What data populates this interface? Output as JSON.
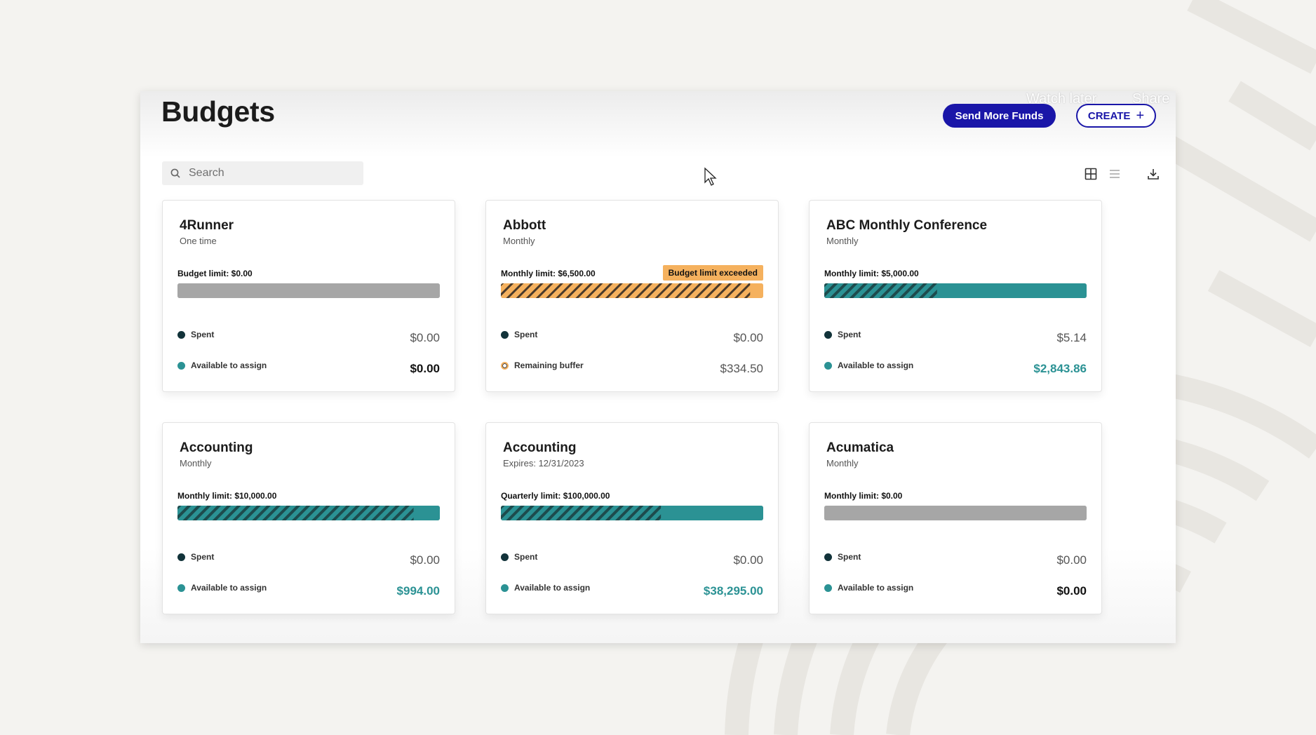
{
  "video_overlay": {
    "watch_later": "Watch later",
    "share": "Share"
  },
  "page": {
    "title": "Budgets"
  },
  "header": {
    "send_funds_label": "Send More Funds",
    "create_label": "CREATE",
    "create_icon": "plus-icon"
  },
  "search": {
    "placeholder": "Search",
    "icon": "search-icon"
  },
  "view_controls": {
    "grid_icon": "grid-view-icon",
    "list_icon": "list-view-icon",
    "download_icon": "download-icon"
  },
  "colors": {
    "accent": "#1a16a8",
    "teal": "#2b9294",
    "dark_teal": "#1d4b4d",
    "orange": "#f5b15e",
    "gray_bar": "#a6a6a6",
    "spent_dot": "#12333a"
  },
  "cards": [
    {
      "title": "4Runner",
      "subtitle": "One time",
      "limit_label": "Budget limit: $0.00",
      "badge": "",
      "bar_style": "empty",
      "spent_fraction": 0,
      "row1": {
        "label": "Spent",
        "value": "$0.00",
        "style": "normal",
        "dot": "spent"
      },
      "row2": {
        "label": "Available to assign",
        "value": "$0.00",
        "style": "strong",
        "dot": "available"
      }
    },
    {
      "title": "Abbott",
      "subtitle": "Monthly",
      "limit_label": "Monthly limit: $6,500.00",
      "badge": "Budget limit exceeded",
      "bar_style": "exceeded",
      "spent_fraction": 0.95,
      "row1": {
        "label": "Spent",
        "value": "$0.00",
        "style": "normal",
        "dot": "spent"
      },
      "row2": {
        "label": "Remaining buffer",
        "value": "$334.50",
        "style": "normal",
        "dot": "buffer"
      }
    },
    {
      "title": "ABC Monthly Conference",
      "subtitle": "Monthly",
      "limit_label": "Monthly limit: $5,000.00",
      "badge": "",
      "bar_style": "normal",
      "spent_fraction": 0.43,
      "row1": {
        "label": "Spent",
        "value": "$5.14",
        "style": "normal",
        "dot": "spent"
      },
      "row2": {
        "label": "Available to assign",
        "value": "$2,843.86",
        "style": "teal",
        "dot": "available"
      }
    },
    {
      "title": "Accounting",
      "subtitle": "Monthly",
      "limit_label": "Monthly limit: $10,000.00",
      "badge": "",
      "bar_style": "normal",
      "spent_fraction": 0.9,
      "row1": {
        "label": "Spent",
        "value": "$0.00",
        "style": "normal",
        "dot": "spent"
      },
      "row2": {
        "label": "Available to assign",
        "value": "$994.00",
        "style": "teal",
        "dot": "available"
      }
    },
    {
      "title": "Accounting",
      "subtitle": "Expires: 12/31/2023",
      "limit_label": "Quarterly limit: $100,000.00",
      "badge": "",
      "bar_style": "normal",
      "spent_fraction": 0.61,
      "row1": {
        "label": "Spent",
        "value": "$0.00",
        "style": "normal",
        "dot": "spent"
      },
      "row2": {
        "label": "Available to assign",
        "value": "$38,295.00",
        "style": "teal",
        "dot": "available"
      }
    },
    {
      "title": "Acumatica",
      "subtitle": "Monthly",
      "limit_label": "Monthly limit: $0.00",
      "badge": "",
      "bar_style": "empty",
      "spent_fraction": 0,
      "row1": {
        "label": "Spent",
        "value": "$0.00",
        "style": "normal",
        "dot": "spent"
      },
      "row2": {
        "label": "Available to assign",
        "value": "$0.00",
        "style": "strong",
        "dot": "available"
      }
    }
  ]
}
